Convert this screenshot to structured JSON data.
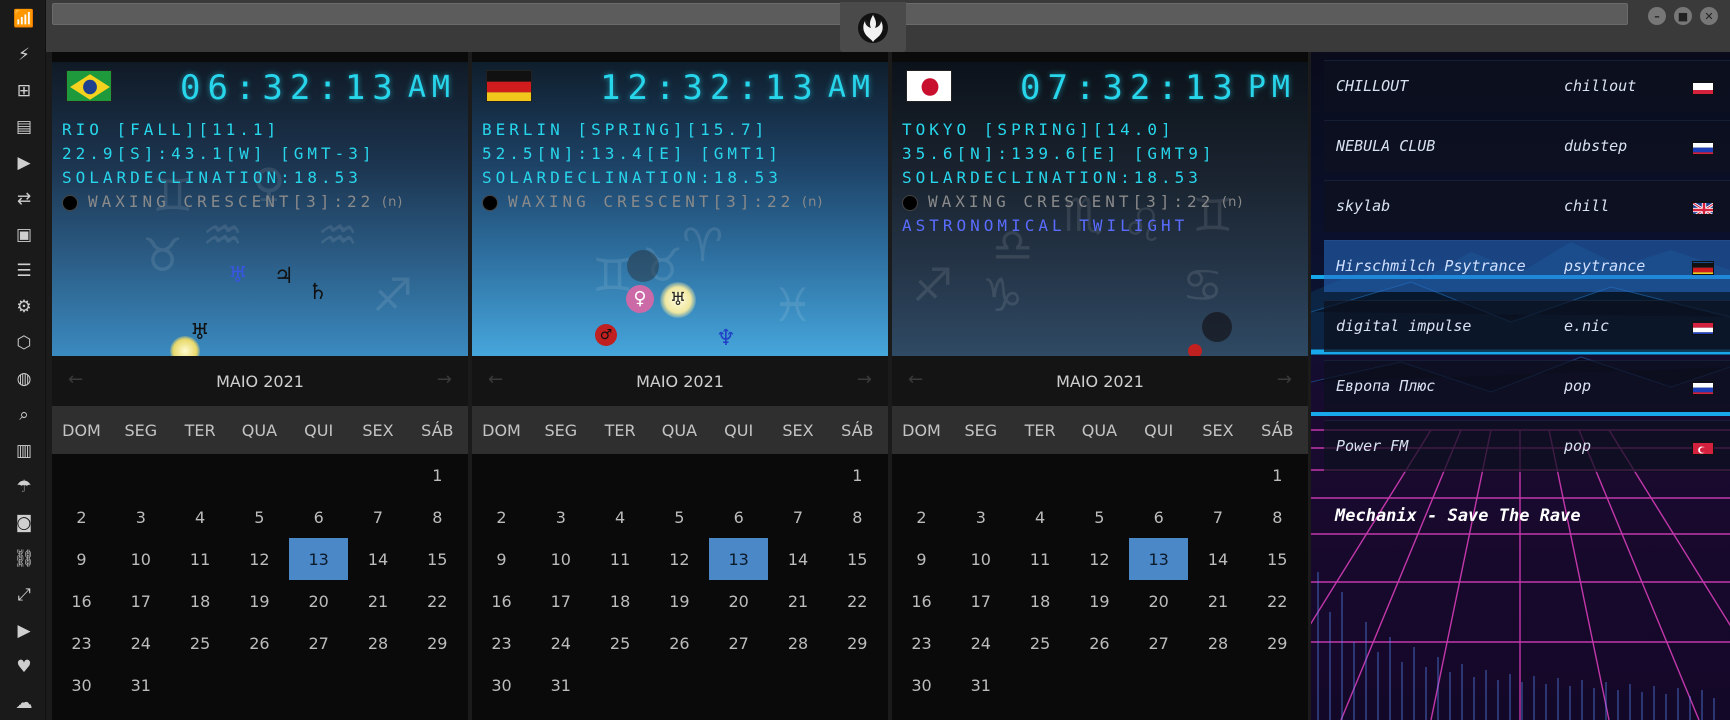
{
  "sidebar": {
    "icons": [
      "wifi-icon",
      "lightning-icon",
      "windows-icon",
      "archive-icon",
      "play-icon",
      "translate-icon",
      "image-icon",
      "news-icon",
      "gear-badge-icon",
      "hexagon-icon",
      "globe-icon",
      "search-icon",
      "map-icon",
      "umbrella-icon",
      "contacts-icon",
      "link-icon",
      "expand-icon",
      "youtube-icon",
      "heart-icon",
      "cloud-icon"
    ]
  },
  "titlebar": {
    "logo": "rebel-alliance-icon",
    "buttons": [
      "minimize",
      "maximize",
      "close"
    ]
  },
  "clocks": [
    {
      "flag": "brazil",
      "time": "06:32:13",
      "ampm": "AM",
      "line1": "RIO [FALL][11.1]",
      "line2": "22.9[S]:43.1[W] [GMT-3]",
      "line3": "SOLARDECLINATION:18.53",
      "moon": "WAXING CRESCENT[3]:22",
      "moon_suffix": "(n)",
      "twilight": "",
      "month": "MAIO 2021"
    },
    {
      "flag": "germany",
      "time": "12:32:13",
      "ampm": "AM",
      "line1": "BERLIN [SPRING][15.7]",
      "line2": "52.5[N]:13.4[E] [GMT1]",
      "line3": "SOLARDECLINATION:18.53",
      "moon": "WAXING CRESCENT[3]:22",
      "moon_suffix": "(n)",
      "twilight": "",
      "month": "MAIO 2021"
    },
    {
      "flag": "japan",
      "time": "07:32:13",
      "ampm": "PM",
      "line1": "TOKYO [SPRING][14.0]",
      "line2": "35.6[N]:139.6[E] [GMT9]",
      "line3": "SOLARDECLINATION:18.53",
      "moon": "WAXING CRESCENT[3]:22",
      "moon_suffix": "(n)",
      "twilight": "ASTRONOMICAL TWILIGHT",
      "month": "MAIO 2021"
    }
  ],
  "calendar": {
    "weekdays": [
      "DOM",
      "SEG",
      "TER",
      "QUA",
      "QUI",
      "SEX",
      "SÁB"
    ],
    "first_weekday_index": 6,
    "days_in_month": 31,
    "today": 13,
    "nav_prev": "←",
    "nav_next": "→"
  },
  "radio": {
    "stations": [
      {
        "name": "CHILLOUT",
        "genre": "chillout",
        "flag": "poland",
        "selected": false
      },
      {
        "name": "NEBULA CLUB",
        "genre": "dubstep",
        "flag": "russia",
        "selected": false
      },
      {
        "name": "skylab",
        "genre": "chill",
        "flag": "uk",
        "selected": false
      },
      {
        "name": "Hirschmilch Psytrance",
        "genre": "psytrance",
        "flag": "germany",
        "selected": true
      },
      {
        "name": "digital impulse",
        "genre": "e.nic",
        "flag": "croatia",
        "selected": false
      },
      {
        "name": "Европа Плюс",
        "genre": "pop",
        "flag": "russia",
        "selected": false
      },
      {
        "name": "Power FM",
        "genre": "pop",
        "flag": "turkey",
        "selected": false
      }
    ],
    "now_playing": "Mechanix - Save The Rave"
  }
}
